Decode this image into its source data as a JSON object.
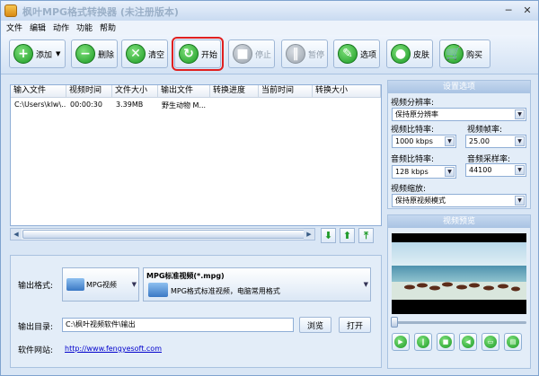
{
  "window": {
    "title": "枫叶MPG格式转换器   (未注册版本)"
  },
  "menu": [
    "文件",
    "编辑",
    "动作",
    "功能",
    "帮助"
  ],
  "toolbar": {
    "add": "添加",
    "delete": "删除",
    "clear": "清空",
    "start": "开始",
    "stop": "停止",
    "pause": "暂停",
    "options": "选项",
    "skin": "皮肤",
    "buy": "购买"
  },
  "filelist": {
    "columns": [
      "输入文件",
      "视频时间",
      "文件大小",
      "输出文件",
      "转换进度",
      "当前时间",
      "转换大小"
    ],
    "rows": [
      [
        "C:\\Users\\klw\\...",
        "00:00:30",
        "3.39MB",
        "野生动物 M...",
        "",
        "",
        ""
      ]
    ]
  },
  "bottom": {
    "format_label": "输出格式:",
    "format_value": "MPG视频",
    "format_title": "MPG标准视频(*.mpg)",
    "format_desc": "MPG格式标准视频，电脑常用格式",
    "dir_label": "输出目录:",
    "dir_value": "C:\\枫叶视频软件\\输出",
    "browse": "浏览",
    "open": "打开",
    "website_label": "软件网站:",
    "website_url": "http://www.fengyesoft.com"
  },
  "settings": {
    "title": "设置选项",
    "resolution_label": "视频分辨率:",
    "resolution_value": "保持原分辨率",
    "video_bitrate_label": "视频比特率:",
    "video_bitrate_value": "1000 kbps",
    "framerate_label": "视频帧率:",
    "framerate_value": "25.00",
    "audio_bitrate_label": "音频比特率:",
    "audio_bitrate_value": "128 kbps",
    "samplerate_label": "音频采样率:",
    "samplerate_value": "44100",
    "scale_label": "视频缩放:",
    "scale_value": "保持原视频模式"
  },
  "preview": {
    "title": "视频预览"
  },
  "colors": {
    "highlight": "#e02020",
    "accent_green": "#1b9a24"
  }
}
